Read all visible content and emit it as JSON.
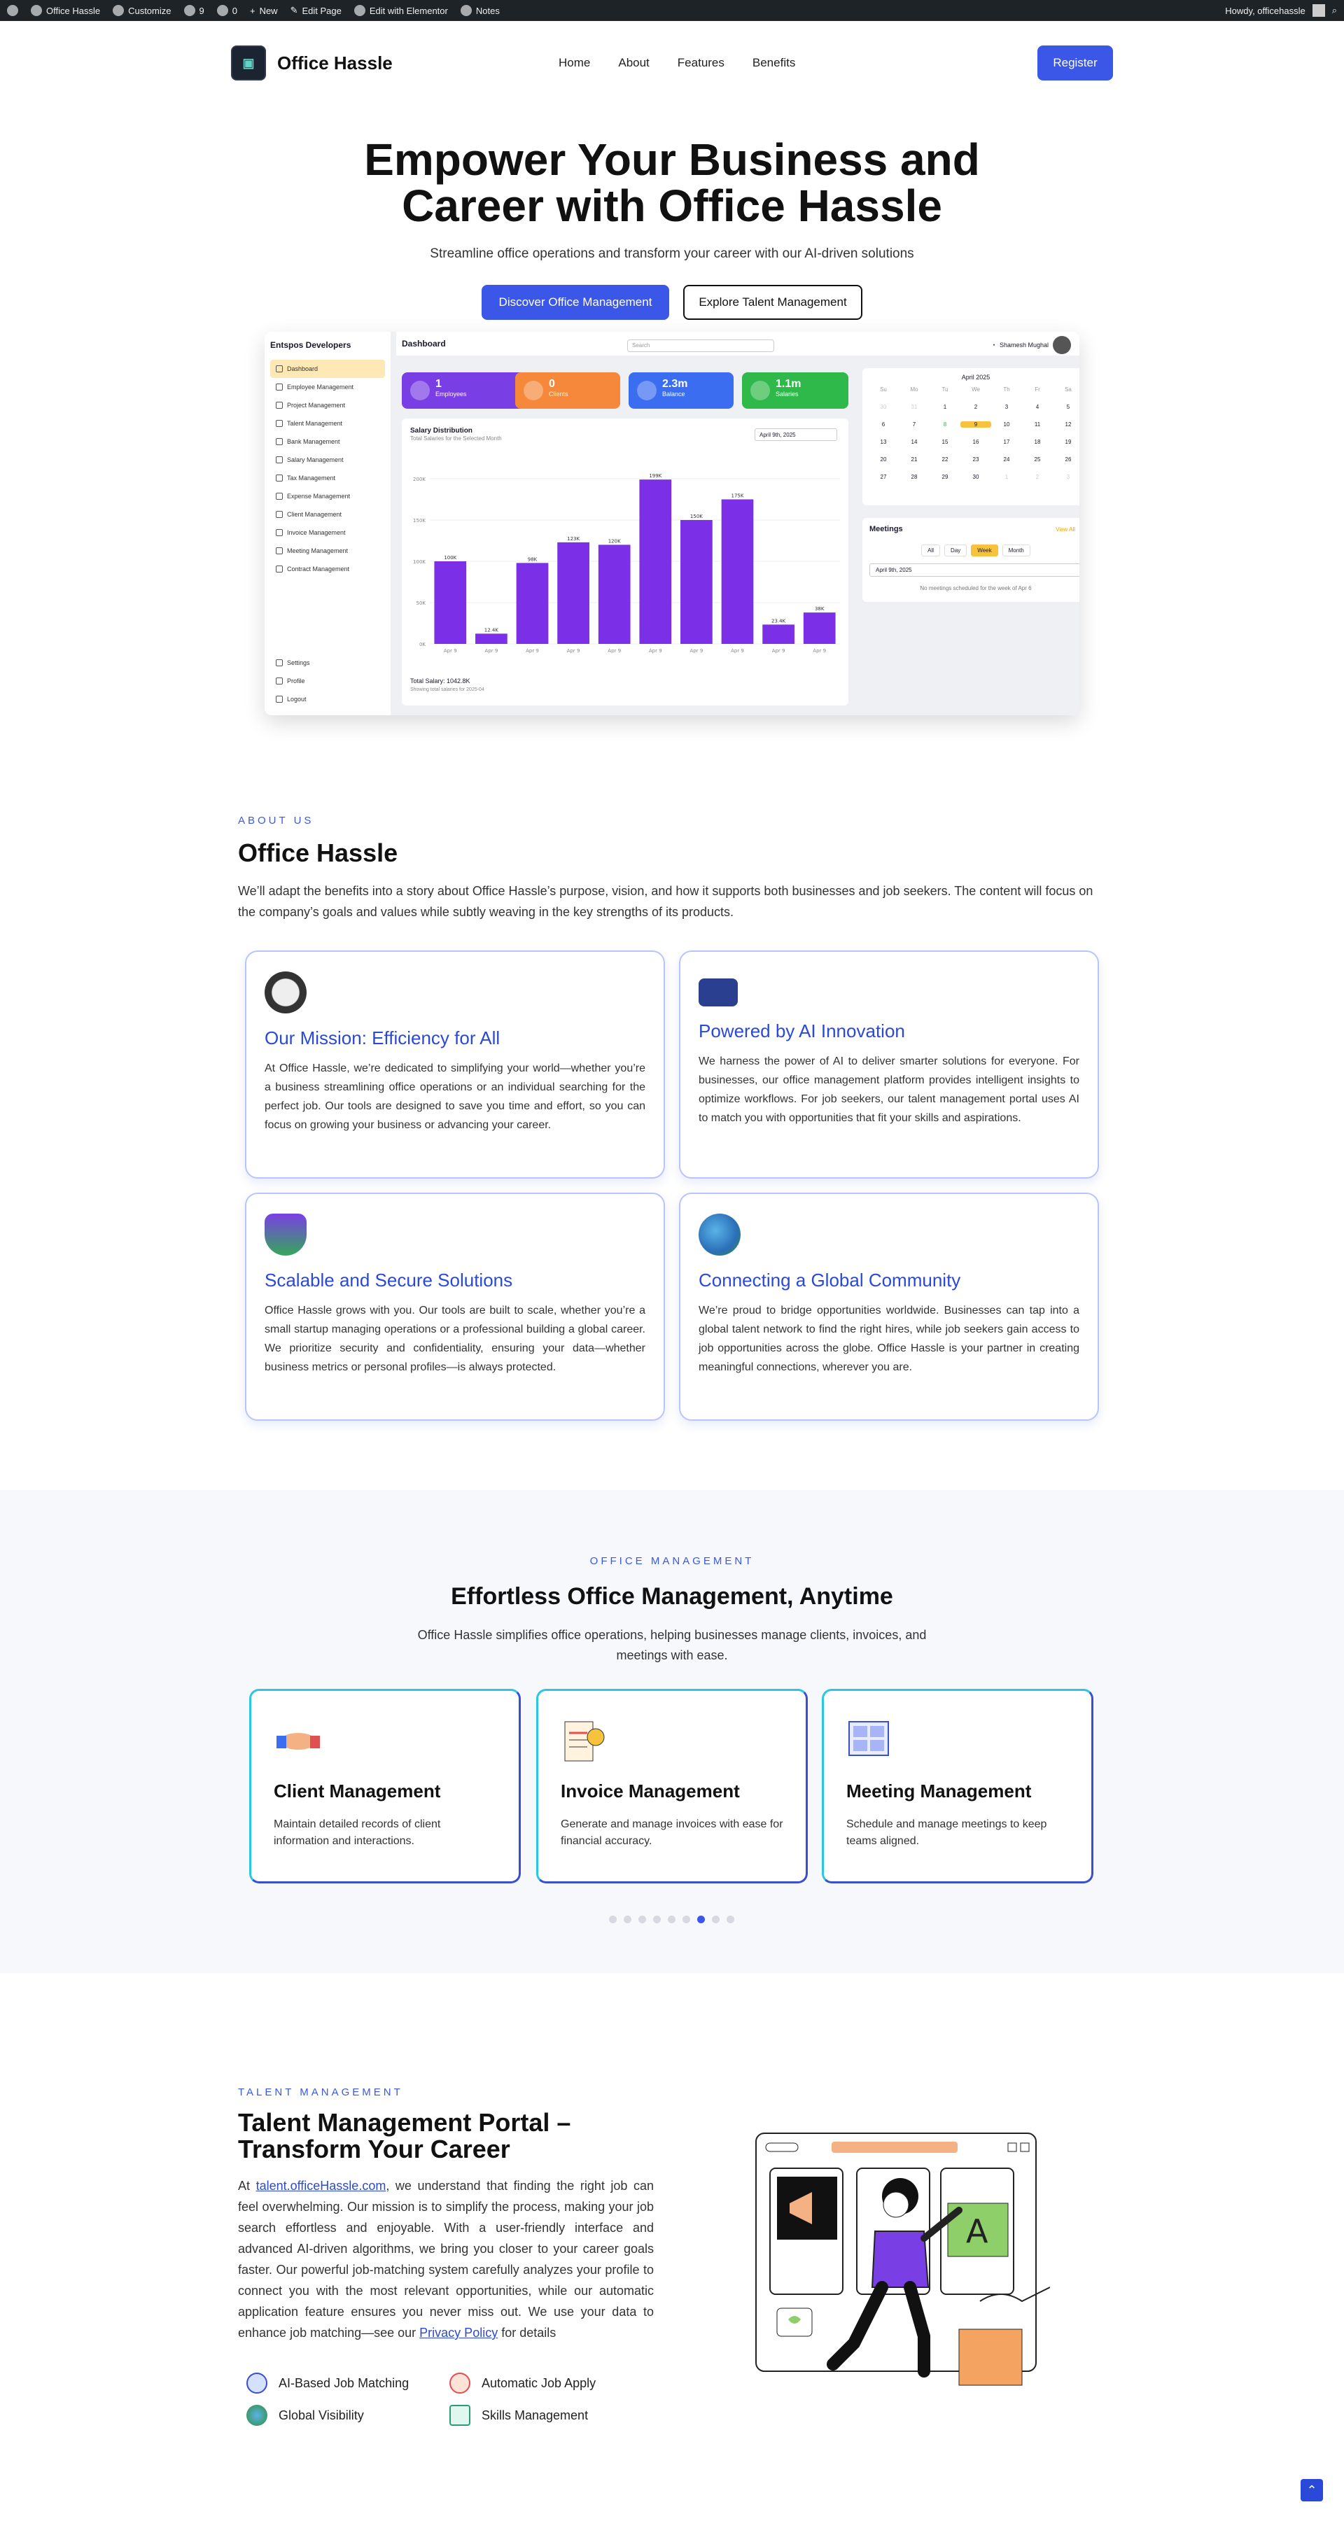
{
  "adminbar": {
    "site": "Office Hassle",
    "customize": "Customize",
    "updates": "9",
    "comments": "0",
    "new": "New",
    "edit_page": "Edit Page",
    "elementor": "Edit with Elementor",
    "notes": "Notes",
    "howdy": "Howdy, officehassle"
  },
  "header": {
    "logo_text": "Office Hassle",
    "nav": [
      "Home",
      "About",
      "Features",
      "Benefits"
    ],
    "register": "Register"
  },
  "hero": {
    "title_line1": "Empower Your Business and",
    "title_line2": "Career with Office Hassle",
    "subtitle": "Streamline office operations and transform your career with our AI-driven solutions",
    "btn_primary": "Discover Office Management",
    "btn_secondary": "Explore Talent Management"
  },
  "dashboard": {
    "brand": "Entspos Developers",
    "menu": [
      "Dashboard",
      "Employee Management",
      "Project Management",
      "Talent Management",
      "Bank Management",
      "Salary Management",
      "Tax Management",
      "Expense Management",
      "Client Management",
      "Invoice Management",
      "Meeting Management",
      "Contract Management"
    ],
    "bottom_menu": [
      "Settings",
      "Profile",
      "Logout"
    ],
    "title": "Dashboard",
    "search": "Search",
    "user": "Shamesh Mughal",
    "stats": [
      {
        "value": "1",
        "label": "Employees",
        "color": "#7a3fe4"
      },
      {
        "value": "0",
        "label": "Clients",
        "color": "#f5883b"
      },
      {
        "value": "2.3m",
        "label": "Balance",
        "color": "#3a6df0"
      },
      {
        "value": "1.1m",
        "label": "Salaries",
        "color": "#2fb94a"
      }
    ],
    "chart_title": "Salary Distribution",
    "chart_sub": "Total Salaries for the Selected Month",
    "chart_date": "April 9th, 2025",
    "total": "Total Salary: 1042.8K",
    "total_sub": "Showing total salaries for 2025-04",
    "calendar": {
      "month": "April 2025",
      "days": [
        "Su",
        "Mo",
        "Tu",
        "We",
        "Th",
        "Fr",
        "Sa"
      ],
      "dates": [
        "30",
        "31",
        "1",
        "2",
        "3",
        "4",
        "5",
        "6",
        "7",
        "8",
        "9",
        "10",
        "11",
        "12",
        "13",
        "14",
        "15",
        "16",
        "17",
        "18",
        "19",
        "20",
        "21",
        "22",
        "23",
        "24",
        "25",
        "26",
        "27",
        "28",
        "29",
        "30",
        "1",
        "2",
        "3"
      ]
    },
    "meetings": {
      "title": "Meetings",
      "view_all": "View All",
      "tabs": [
        "All",
        "Day",
        "Week",
        "Month"
      ],
      "date": "April 9th, 2025",
      "empty": "No meetings scheduled for the week of Apr 6"
    }
  },
  "chart_data": {
    "type": "bar",
    "categories": [
      "Apr 9",
      "Apr 9",
      "Apr 9",
      "Apr 9",
      "Apr 9",
      "Apr 9",
      "Apr 9",
      "Apr 9",
      "Apr 9",
      "Apr 9"
    ],
    "values": [
      100,
      12.4,
      98,
      123,
      120,
      199,
      150,
      175,
      23.4,
      38
    ],
    "data_labels": [
      "100K",
      "12.4K",
      "98K",
      "123K",
      "120K",
      "199K",
      "150K",
      "175K",
      "23.4K",
      "38K"
    ],
    "y_ticks": [
      "0K",
      "50K",
      "100K",
      "150K",
      "200K"
    ],
    "ylim": [
      0,
      200
    ],
    "color": "#7b2fe6"
  },
  "about": {
    "eyebrow": "ABOUT US",
    "title": "Office Hassle",
    "text": "We’ll adapt the benefits into a story about Office Hassle’s purpose, vision, and how it supports both businesses and job seekers. The content will focus on the company’s goals and values while subtly weaving in the key strengths of its products.",
    "features": [
      {
        "title": "Our Mission: Efficiency for All",
        "text": "At Office Hassle, we’re dedicated to simplifying your world—whether you’re a business streamlining office operations or an individual searching for the perfect job. Our tools are designed to save you time and effort, so you can focus on growing your business or advancing your career."
      },
      {
        "title": "Powered by AI Innovation",
        "text": "We harness the power of AI to deliver smarter solutions for everyone. For businesses, our office management platform provides intelligent insights to optimize workflows. For job seekers, our talent management portal uses AI to match you with opportunities that fit your skills and aspirations."
      },
      {
        "title": "Scalable and Secure Solutions",
        "text": "Office Hassle grows with you. Our tools are built to scale, whether you’re a small startup managing operations or a professional building a global career. We prioritize security and confidentiality, ensuring your data—whether business metrics or personal profiles—is always protected."
      },
      {
        "title": "Connecting a Global Community",
        "text": "We’re proud to bridge opportunities worldwide. Businesses can tap into a global talent network to find the right hires, while job seekers gain access to job opportunities across the globe. Office Hassle is your partner in creating meaningful connections, wherever you are."
      }
    ]
  },
  "office": {
    "eyebrow": "OFFICE MANAGEMENT",
    "title": "Effortless Office Management, Anytime",
    "text": "Office Hassle simplifies office operations, helping businesses manage clients, invoices, and meetings with ease.",
    "cards": [
      {
        "title": "Client Management",
        "text": "Maintain detailed records of client information and interactions."
      },
      {
        "title": "Invoice Management",
        "text": "Generate and manage invoices with ease for financial accuracy."
      },
      {
        "title": "Meeting Management",
        "text": "Schedule and manage meetings to keep teams aligned."
      }
    ]
  },
  "talent": {
    "eyebrow": "TALENT MANAGEMENT",
    "title_line1": "Talent Management Portal –",
    "title_line2": "Transform Your Career",
    "text_pre": "At ",
    "link": "talent.officeHassle.com",
    "text_mid": ", we understand that finding the right job can feel overwhelming. Our mission is to simplify the process, making your job search effortless and enjoyable. With a user-friendly interface and advanced AI-driven algorithms, we bring you closer to your career goals faster. Our powerful job-matching system carefully analyzes your profile to connect you with the most relevant opportunities, while our automatic application feature ensures you never miss out. We use your data to enhance job matching—see our ",
    "policy": "Privacy Policy",
    "text_post": " for details",
    "features": [
      "AI-Based Job Matching",
      "Automatic Job Apply",
      "Global Visibility",
      "Skills Management"
    ]
  }
}
